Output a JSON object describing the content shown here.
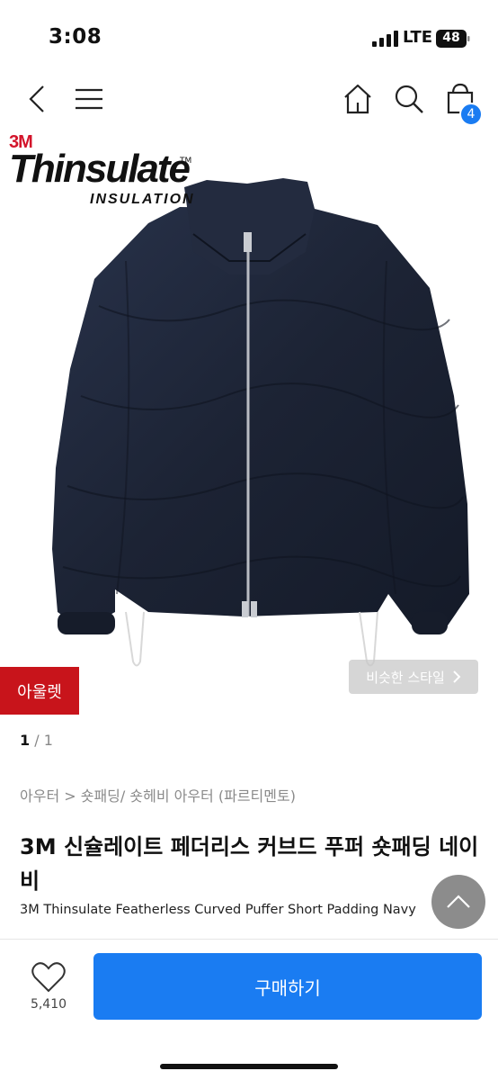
{
  "status": {
    "time": "3:08",
    "network": "LTE",
    "battery": "48"
  },
  "nav": {
    "cart_count": "4",
    "icons": [
      "back-icon",
      "menu-icon",
      "home-icon",
      "search-icon",
      "cart-icon"
    ]
  },
  "hero": {
    "brand_3m": "3M",
    "brand_name": "Thinsulate",
    "brand_tm": "TM",
    "brand_sub": "INSULATION",
    "outlet_badge": "아울렛",
    "similar_style": "비슷한 스타일",
    "pager_current": "1",
    "pager_sep": " / ",
    "pager_total": "1"
  },
  "product": {
    "breadcrumb": "아우터 > 숏패딩/ 숏헤비 아우터 (파르티멘토)",
    "title_ko": "3M 신슐레이트 페더리스 커브드 푸퍼 숏패딩 네이비",
    "title_en": "3M Thinsulate Featherless Curved Puffer Short Padding Navy"
  },
  "footer": {
    "wish_count": "5,410",
    "buy_label": "구매하기"
  },
  "colors": {
    "accent": "#1a7cf2",
    "outlet": "#c8141b",
    "jacket": "#1e2636"
  }
}
